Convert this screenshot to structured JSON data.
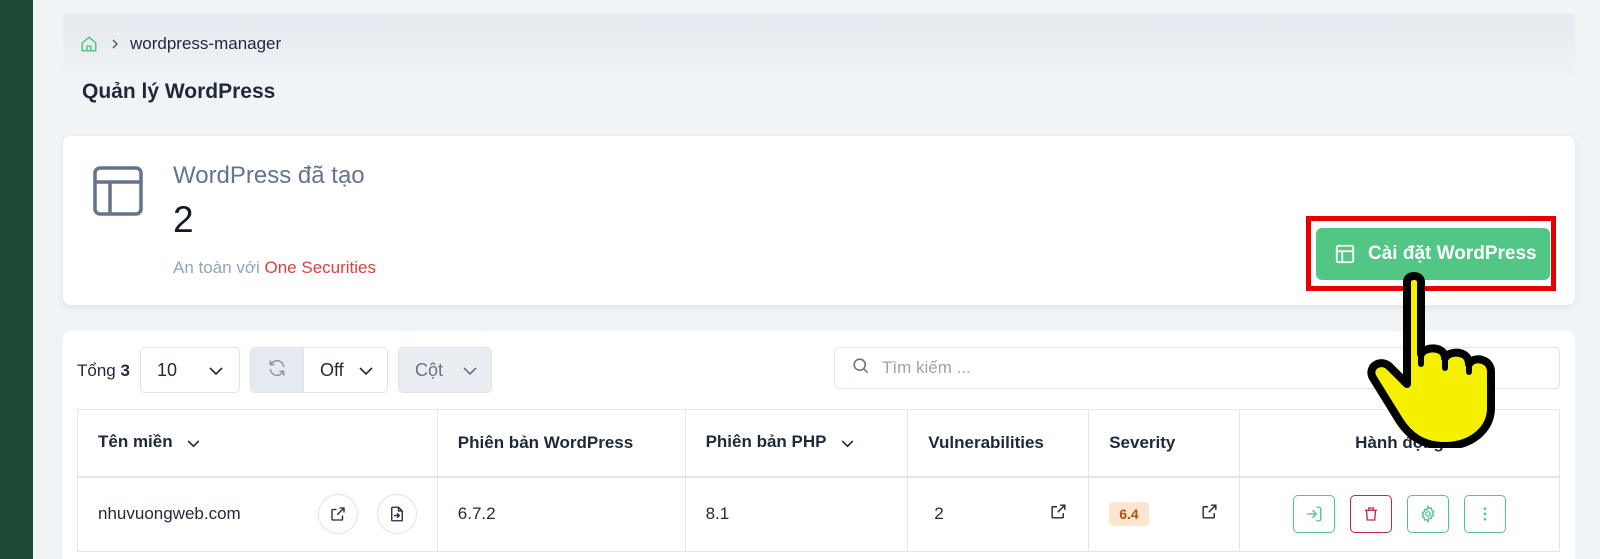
{
  "breadcrumb": {
    "path": "wordpress-manager"
  },
  "page": {
    "title": "Quản lý WordPress"
  },
  "stats": {
    "title": "WordPress đã tạo",
    "value": "2",
    "subtitle_prefix": "An toàn với",
    "subtitle_brand": "One Securities",
    "install_button": "Cài đặt WordPress"
  },
  "toolbar": {
    "total_label": "Tổng",
    "total_value": "3",
    "page_size": "10",
    "refresh_value": "Off",
    "columns_label": "Cột",
    "search_placeholder": "Tìm kiếm ..."
  },
  "table": {
    "headers": {
      "domain": "Tên miền",
      "wp_version": "Phiên bản WordPress",
      "php_version": "Phiên bản PHP",
      "vulnerabilities": "Vulnerabilities",
      "severity": "Severity",
      "actions": "Hành động"
    },
    "rows": [
      {
        "domain": "nhuvuongweb.com",
        "wp_version": "6.7.2",
        "php_version": "8.1",
        "vulnerabilities": "2",
        "severity": "6.4"
      }
    ]
  },
  "colors": {
    "accent": "#52c685",
    "danger": "#c2274a",
    "brand_red": "#e03e3e",
    "sidebar": "#1c4a35"
  }
}
